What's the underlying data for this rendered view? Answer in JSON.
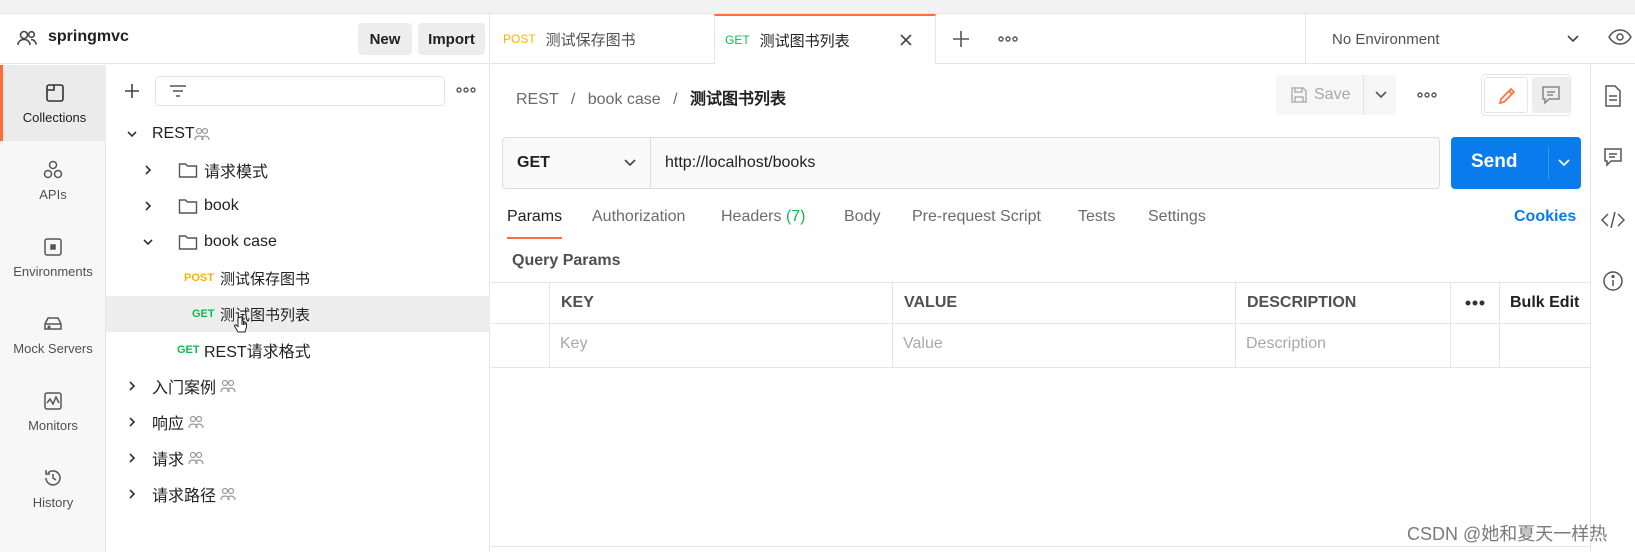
{
  "workspace": {
    "name": "springmvc",
    "new_label": "New",
    "import_label": "Import"
  },
  "rail": {
    "items": [
      {
        "label": "Collections",
        "icon": "collections-icon",
        "active": true
      },
      {
        "label": "APIs",
        "icon": "apis-icon"
      },
      {
        "label": "Environments",
        "icon": "environments-icon"
      },
      {
        "label": "Mock Servers",
        "icon": "mock-servers-icon"
      },
      {
        "label": "Monitors",
        "icon": "monitors-icon"
      },
      {
        "label": "History",
        "icon": "history-icon"
      }
    ]
  },
  "tree": {
    "rest": "REST",
    "folder1": "请求模式",
    "folder2": "book",
    "folder3": "book case",
    "req1_method": "POST",
    "req1": "测试保存图书",
    "req2_method": "GET",
    "req2": "测试图书列表",
    "req3_method": "GET",
    "req3": "REST请求格式",
    "col2": "入门案例",
    "col3": "响应",
    "col4": "请求",
    "col5": "请求路径"
  },
  "tabs": {
    "tab1_method": "POST",
    "tab1_label": "测试保存图书",
    "tab2_method": "GET",
    "tab2_label": "测试图书列表"
  },
  "environment": {
    "selected": "No Environment"
  },
  "breadcrumb": {
    "part1": "REST",
    "part2": "book case",
    "current": "测试图书列表",
    "sep": "/"
  },
  "toolbar": {
    "save_label": "Save"
  },
  "request": {
    "method": "GET",
    "url": "http://localhost/books",
    "send_label": "Send"
  },
  "param_tabs": {
    "params": "Params",
    "authorization": "Authorization",
    "headers": "Headers",
    "headers_count": "(7)",
    "body": "Body",
    "prerequest": "Pre-request Script",
    "tests": "Tests",
    "settings": "Settings",
    "cookies": "Cookies"
  },
  "query_params": {
    "title": "Query Params",
    "col_key": "KEY",
    "col_value": "VALUE",
    "col_description": "DESCRIPTION",
    "bulk_edit": "Bulk Edit",
    "ph_key": "Key",
    "ph_value": "Value",
    "ph_description": "Description"
  },
  "watermark": "CSDN @她和夏天一样热",
  "colors": {
    "accent": "#ff6c37",
    "send": "#097bed",
    "get": "#0cbb52",
    "post": "#f5b400"
  }
}
